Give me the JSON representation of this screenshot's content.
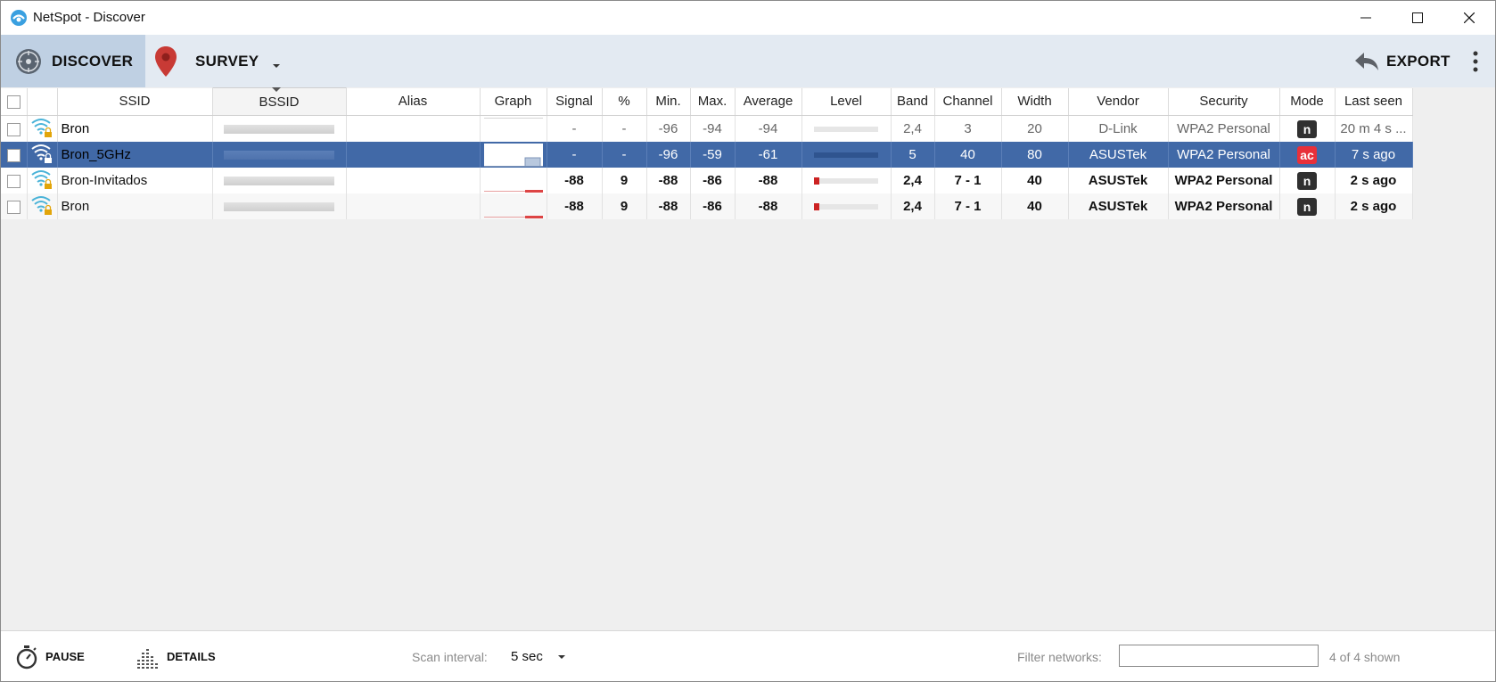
{
  "window": {
    "title": "NetSpot - Discover"
  },
  "toolbar": {
    "discover_label": "DISCOVER",
    "survey_label": "SURVEY",
    "export_label": "EXPORT"
  },
  "table": {
    "columns": [
      "SSID",
      "BSSID",
      "Alias",
      "Graph",
      "Signal",
      "%",
      "Min.",
      "Max.",
      "Average",
      "Level",
      "Band",
      "Channel",
      "Width",
      "Vendor",
      "Security",
      "Mode",
      "Last seen"
    ],
    "rows": [
      {
        "ssid": "Bron",
        "signal": "-",
        "pct": "-",
        "min": "-96",
        "max": "-94",
        "avg": "-94",
        "level": 0,
        "band": "2,4",
        "channel": "3",
        "width": "20",
        "vendor": "D-Link",
        "security": "WPA2 Personal",
        "mode": "n",
        "last_seen": "20 m 4 s ..."
      },
      {
        "ssid": "Bron_5GHz",
        "signal": "-",
        "pct": "-",
        "min": "-96",
        "max": "-59",
        "avg": "-61",
        "level": 0,
        "band": "5",
        "channel": "40",
        "width": "80",
        "vendor": "ASUSTek",
        "security": "WPA2 Personal",
        "mode": "ac",
        "last_seen": "7 s ago"
      },
      {
        "ssid": "Bron-Invitados",
        "signal": "-88",
        "pct": "9",
        "min": "-88",
        "max": "-86",
        "avg": "-88",
        "level": 0.09,
        "band": "2,4",
        "channel": "7 - 1",
        "width": "40",
        "vendor": "ASUSTek",
        "security": "WPA2 Personal",
        "mode": "n",
        "last_seen": "2 s ago"
      },
      {
        "ssid": "Bron",
        "signal": "-88",
        "pct": "9",
        "min": "-88",
        "max": "-86",
        "avg": "-88",
        "level": 0.09,
        "band": "2,4",
        "channel": "7 - 1",
        "width": "40",
        "vendor": "ASUSTek",
        "security": "WPA2 Personal",
        "mode": "n",
        "last_seen": "2 s ago"
      }
    ]
  },
  "statusbar": {
    "pause_label": "PAUSE",
    "details_label": "DETAILS",
    "scan_interval_label": "Scan interval:",
    "scan_interval_value": "5 sec",
    "filter_label": "Filter networks:",
    "filter_value": "",
    "shown_count": "4 of 4 shown"
  },
  "colors": {
    "selected_row": "#4169a7",
    "toolbar_bg": "#e3eaf2",
    "active_tab": "#bfd0e3",
    "ac_badge": "#e8303a",
    "n_badge": "#303030",
    "level_red": "#cc2222"
  },
  "icons": [
    "app-logo-icon",
    "minimize-icon",
    "maximize-icon",
    "close-icon",
    "discover-compass-icon",
    "survey-pin-icon",
    "chevron-down-icon",
    "export-arrow-icon",
    "more-vertical-icon",
    "wifi-lock-icon",
    "pause-stopwatch-icon",
    "details-bars-icon"
  ]
}
